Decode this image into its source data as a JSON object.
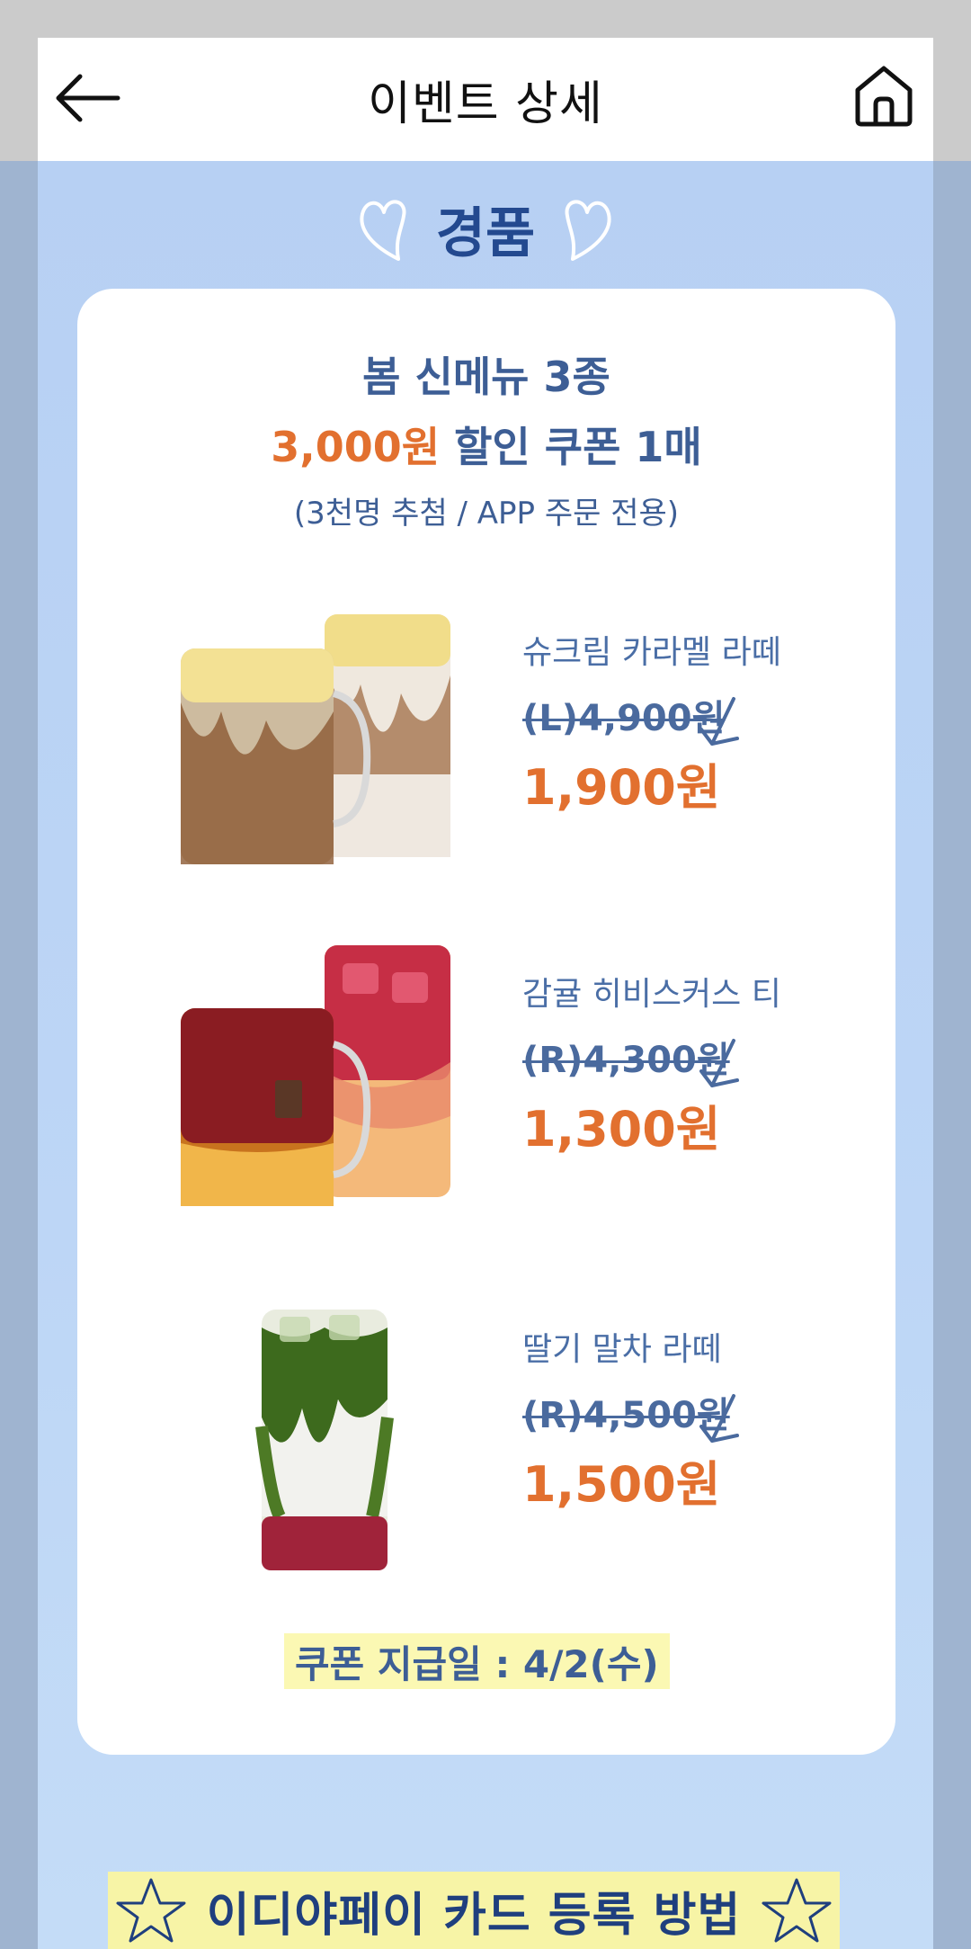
{
  "header": {
    "title": "이벤트 상세"
  },
  "prize": {
    "heading": "경품",
    "line1": "봄 신메뉴 3종",
    "line2_amount": "3,000원",
    "line2_rest": " 할인 쿠폰 1매",
    "line3": "(3천명 추첨 / APP 주문 전용)"
  },
  "items": [
    {
      "name": "슈크림 카라멜 라떼",
      "original_price": "(L)4,900원",
      "sale_price": "1,900원"
    },
    {
      "name": "감귤 히비스커스 티",
      "original_price": "(R)4,300원",
      "sale_price": "1,300원"
    },
    {
      "name": "딸기 말차 라떼",
      "original_price": "(R)4,500원",
      "sale_price": "1,500원"
    }
  ],
  "coupon_date": "쿠폰 지급일 : 4/2(수)",
  "banner": {
    "text": "이디야페이 카드 등록 방법"
  },
  "colors": {
    "accent_orange": "#e2702f",
    "navy": "#23498f",
    "background_blue": "#b7d0f3"
  },
  "icons": [
    "back-arrow-icon",
    "home-icon",
    "heart-icon",
    "star-icon"
  ]
}
